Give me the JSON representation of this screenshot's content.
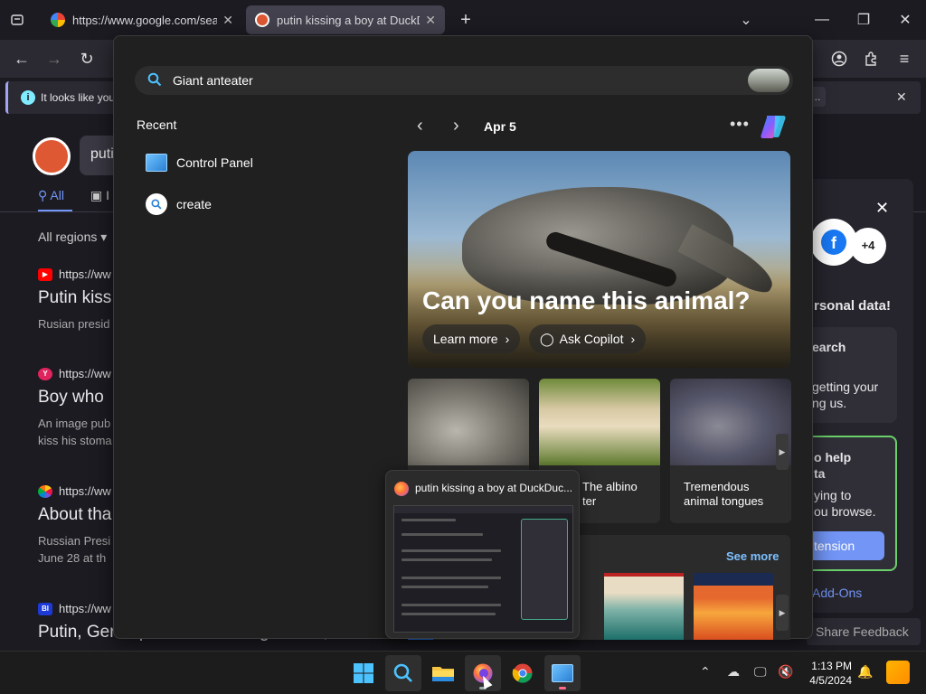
{
  "browser": {
    "tabs": [
      {
        "label": "https://www.google.com/search?"
      },
      {
        "label": "putin kissing a boy at DuckDuckGo"
      }
    ],
    "notification_text": "It looks like you"
  },
  "page": {
    "search_value": "putin",
    "tabs": {
      "all": "All",
      "images": "I"
    },
    "region": "All regions",
    "results": [
      {
        "url": "https://ww",
        "title": "Putin kiss",
        "snippet": [
          "Rusian presid"
        ]
      },
      {
        "url": "https://ww",
        "title": "Boy who",
        "snippet": [
          "An image pub",
          "kiss his stoma"
        ]
      },
      {
        "url": "https://ww",
        "title": "About tha",
        "snippet": [
          "Russian Presi",
          "June 28 at th"
        ]
      },
      {
        "url": "https://ww",
        "title": "Putin, Germaphobe With Long Tables, Too"
      }
    ],
    "right_panel": {
      "plus_count": "+4",
      "personal_data": "rsonal data!",
      "search_block": [
        "earch",
        "getting your",
        "ng us."
      ],
      "help_block": [
        "o help",
        "ta",
        "ying to",
        "ou browse."
      ],
      "extension_label": "tension",
      "addons": "Add-Ons"
    },
    "share_feedback": "Share Feedback"
  },
  "popup": {
    "search_value": "Giant anteater",
    "recent_heading": "Recent",
    "recent": [
      {
        "label": "Control Panel"
      },
      {
        "label": "create"
      }
    ],
    "date": "Apr 5",
    "hero_title": "Can you name this animal?",
    "learn_more": "Learn more",
    "ask_copilot": "Ask Copilot",
    "cards": [
      {
        "caption": [
          "",
          ""
        ]
      },
      {
        "caption": [
          "The albino",
          "ter"
        ]
      },
      {
        "caption": [
          "Tremendous",
          "animal tongues"
        ]
      }
    ],
    "see_more": "See more"
  },
  "preview": {
    "title": "putin kissing a boy at DuckDuc..."
  },
  "taskbar": {
    "time": "1:13 PM",
    "date": "4/5/2024"
  },
  "colors": {
    "accent_blue": "#7295f6",
    "ddg_orange": "#de5833",
    "link_blue": "#7dc1ff",
    "green_border": "#6bd06b"
  }
}
